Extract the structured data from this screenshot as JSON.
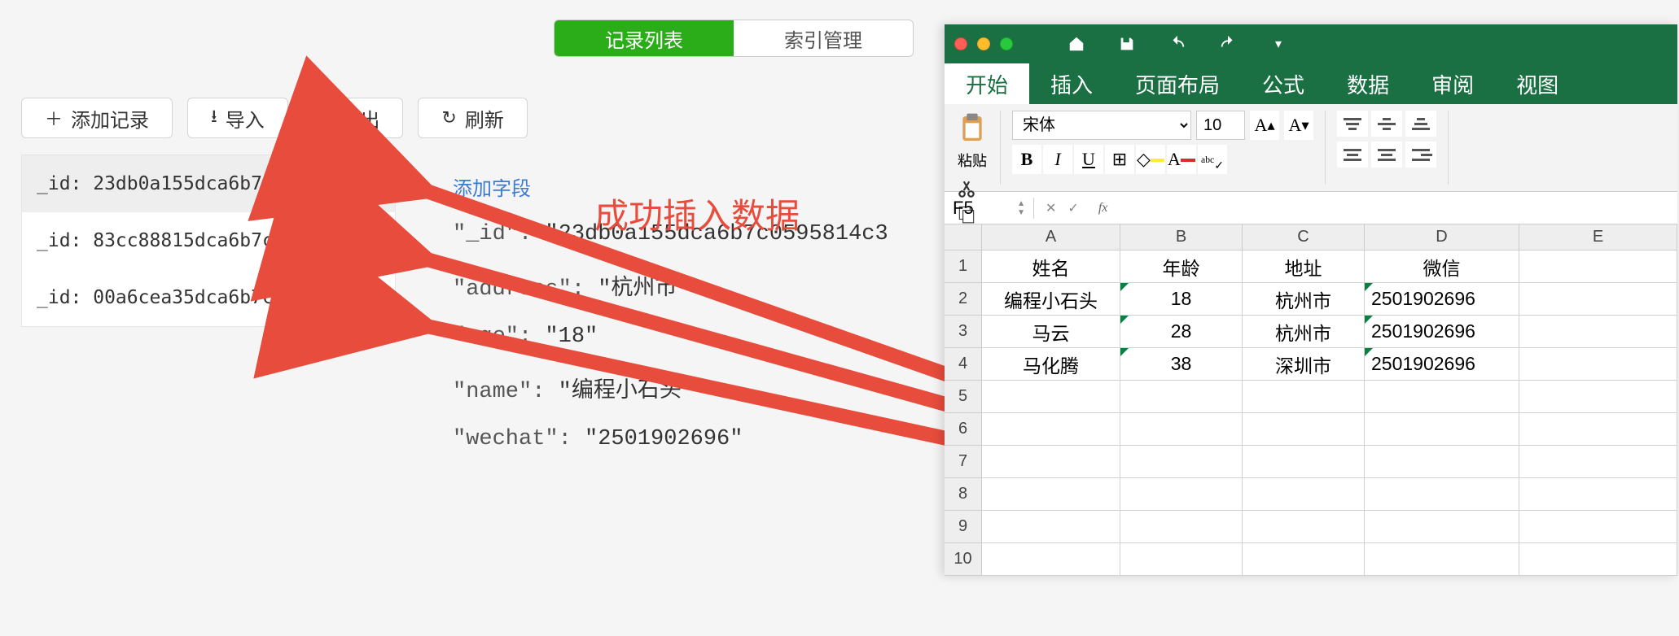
{
  "top_tabs": {
    "records": "记录列表",
    "index": "索引管理"
  },
  "toolbar": {
    "add": "添加记录",
    "import": "导入",
    "export": "导出",
    "refresh": "刷新"
  },
  "records": [
    "_id: 23db0a155dca6b7c0595814...",
    "_id: 83cc88815dca6b7c0598e3...",
    "_id: 00a6cea35dca6b7c0596c8..."
  ],
  "detail": {
    "add_field": "添加字段",
    "id_key": "\"_id\":",
    "id_val": "\"23db0a155dca6b7c0595814c3",
    "addr_key": "\"address\":",
    "addr_val": "\"杭州市\"",
    "age_key": "\"age\":",
    "age_val": "\"18\"",
    "name_key": "\"name\":",
    "name_val": "\"编程小石头\"",
    "wechat_key": "\"wechat\":",
    "wechat_val": "\"2501902696\""
  },
  "annotation": "成功插入数据",
  "excel": {
    "ribbon_tabs": [
      "开始",
      "插入",
      "页面布局",
      "公式",
      "数据",
      "审阅",
      "视图"
    ],
    "paste_label": "粘贴",
    "font_name": "宋体",
    "font_size": "10",
    "namebox": "F5",
    "columns": [
      "A",
      "B",
      "C",
      "D",
      "E"
    ],
    "row_nums": [
      "1",
      "2",
      "3",
      "4",
      "5",
      "6",
      "7",
      "8",
      "9",
      "10"
    ],
    "headers": [
      "姓名",
      "年龄",
      "地址",
      "微信"
    ],
    "rows": [
      {
        "name": "编程小石头",
        "age": "18",
        "addr": "杭州市",
        "wechat": "2501902696"
      },
      {
        "name": "马云",
        "age": "28",
        "addr": "杭州市",
        "wechat": "2501902696"
      },
      {
        "name": "马化腾",
        "age": "38",
        "addr": "深圳市",
        "wechat": "2501902696"
      }
    ]
  }
}
